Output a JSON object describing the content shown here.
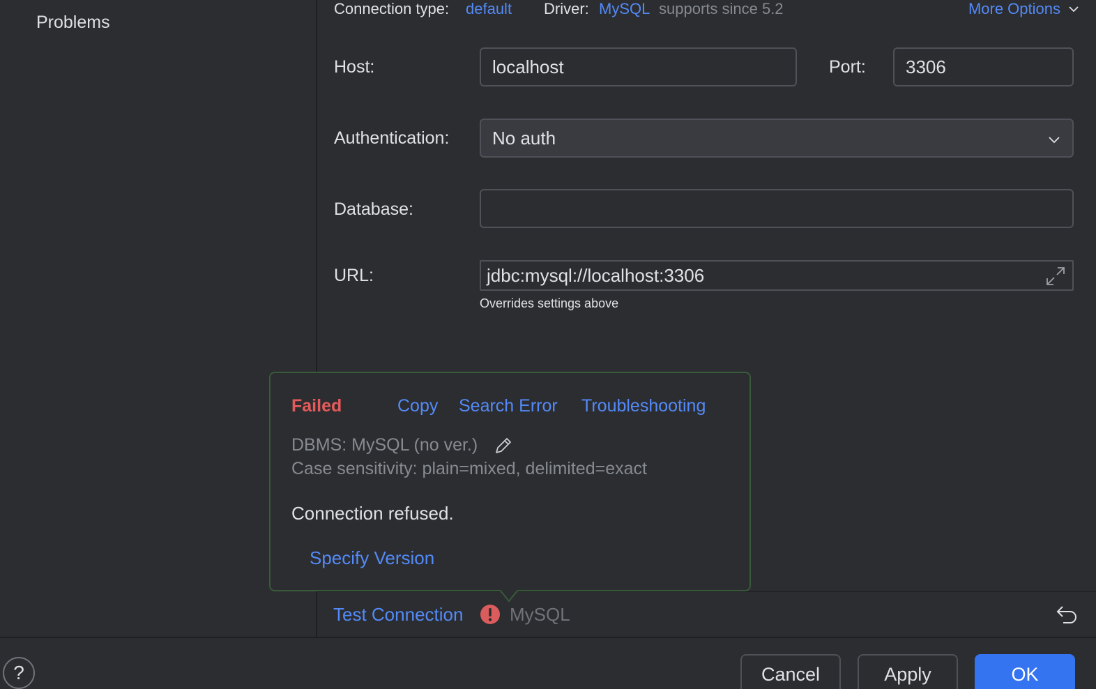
{
  "sidebar": {
    "items": [
      {
        "label": "Problems"
      }
    ]
  },
  "header": {
    "connection_type_label": "Connection type:",
    "connection_type_value": "default",
    "driver_label": "Driver:",
    "driver_value": "MySQL",
    "driver_support": "supports since 5.2",
    "more_options": "More Options"
  },
  "form": {
    "host_label": "Host:",
    "host_value": "localhost",
    "port_label": "Port:",
    "port_value": "3306",
    "auth_label": "Authentication:",
    "auth_value": "No auth",
    "database_label": "Database:",
    "database_value": "",
    "url_label": "URL:",
    "url_value": "jdbc:mysql://localhost:3306",
    "url_hint": "Overrides settings above"
  },
  "popup": {
    "status": "Failed",
    "copy": "Copy",
    "search_error": "Search Error",
    "troubleshooting": "Troubleshooting",
    "dbms": "DBMS: MySQL (no ver.)",
    "case_sensitivity": "Case sensitivity: plain=mixed, delimited=exact",
    "message": "Connection refused.",
    "specify_version": "Specify Version"
  },
  "status_bar": {
    "test_connection": "Test Connection",
    "driver_name": "MySQL"
  },
  "footer": {
    "help": "?",
    "cancel": "Cancel",
    "apply": "Apply",
    "ok": "OK"
  },
  "colors": {
    "background": "#2b2d30",
    "link": "#548af7",
    "error": "#e55b5b",
    "primary_button": "#3574f0",
    "muted_text": "#868a91"
  }
}
